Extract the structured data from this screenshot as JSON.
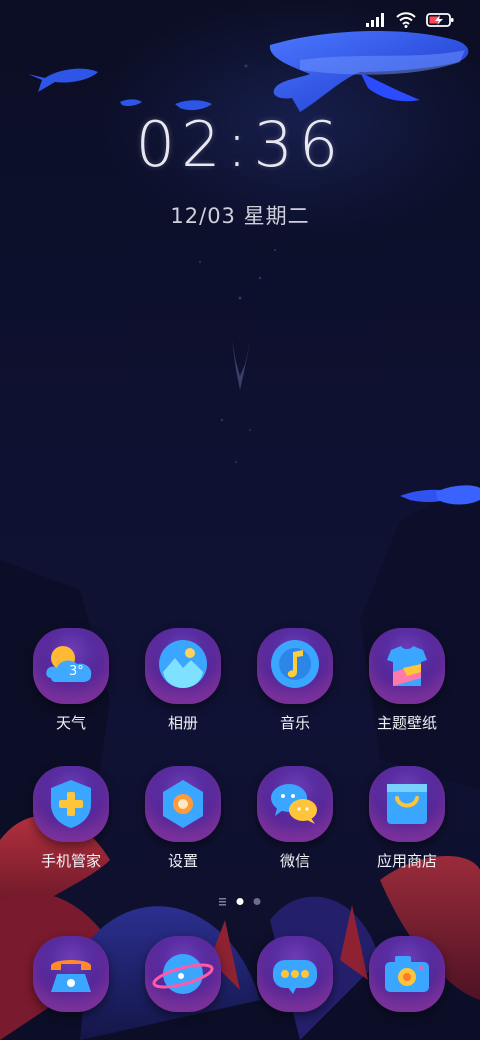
{
  "status_bar": {
    "signal_icon": "signal-bars-icon",
    "wifi_icon": "wifi-icon",
    "battery_icon": "battery-charging-icon"
  },
  "lockscreen": {
    "time": "02:36",
    "date": "12/03 星期二"
  },
  "apps": [
    {
      "label": "天气",
      "icon": "weather-icon",
      "badge": "3°"
    },
    {
      "label": "相册",
      "icon": "gallery-icon"
    },
    {
      "label": "音乐",
      "icon": "music-icon"
    },
    {
      "label": "主题壁纸",
      "icon": "theme-icon"
    },
    {
      "label": "手机管家",
      "icon": "security-shield-icon"
    },
    {
      "label": "设置",
      "icon": "settings-icon"
    },
    {
      "label": "微信",
      "icon": "wechat-icon"
    },
    {
      "label": "应用商店",
      "icon": "app-store-icon"
    }
  ],
  "page_indicator": {
    "pages": 3,
    "current": 2
  },
  "dock": [
    {
      "icon": "phone-icon"
    },
    {
      "icon": "browser-planet-icon"
    },
    {
      "icon": "messages-icon"
    },
    {
      "icon": "camera-icon"
    }
  ],
  "colors": {
    "background": "#0e1130",
    "accent_purple": "#5a2aa8",
    "accent_pink": "#e25bbf",
    "whale_blue": "#1f4bff"
  }
}
